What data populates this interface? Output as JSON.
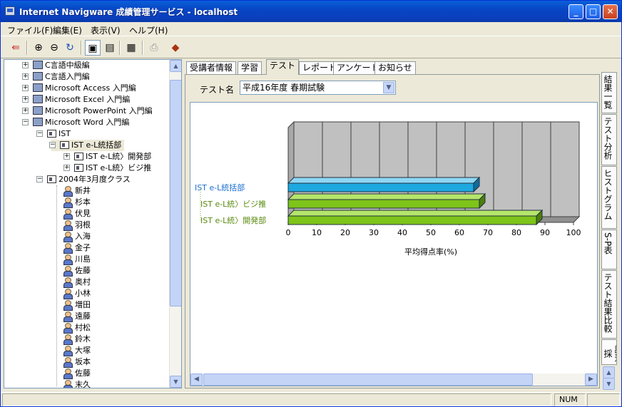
{
  "window": {
    "title": "Internet Navigware 成績管理サービス - localhost"
  },
  "menu": [
    {
      "label": "ファイル(F)"
    },
    {
      "label": "編集(E)"
    },
    {
      "label": "表示(V)"
    },
    {
      "label": "ヘルプ(H)"
    }
  ],
  "toolbar": {
    "icons": [
      "exit-icon",
      "zoom-in-icon",
      "zoom-out-icon",
      "refresh-icon",
      "view-mode-1-icon",
      "view-mode-2-icon",
      "report-icon",
      "print-icon",
      "book-icon"
    ]
  },
  "tree": {
    "courses": [
      "C言語中級編",
      "C言語入門編",
      "Microsoft Access 入門編",
      "Microsoft Excel 入門編",
      "Microsoft PowerPoint 入門編",
      "Microsoft Word 入門編"
    ],
    "org": "IST",
    "org_child": "IST e-L統括部",
    "org_grandchildren": [
      "IST e-L統〉開発部",
      "IST e-L統〉ビジ推"
    ],
    "class": "2004年3月度クラス",
    "students": [
      "新井",
      "杉本",
      "伏見",
      "羽根",
      "入海",
      "金子",
      "川島",
      "佐藤",
      "奥村",
      "小林",
      "増田",
      "遠藤",
      "村松",
      "鈴木",
      "大塚",
      "坂本",
      "佐藤",
      "末久"
    ]
  },
  "tabs": [
    "受講者情報",
    "学習",
    "テスト",
    "レポート",
    "アンケート",
    "お知らせ"
  ],
  "active_tab": "テスト",
  "test_select": {
    "label": "テスト名",
    "value": "平成16年度 春期試験"
  },
  "vertical_tabs": [
    "結果一覧",
    "テスト分析",
    "ヒストグラム",
    "S-P表",
    "テスト結果比較",
    "論述採"
  ],
  "chart_data": {
    "type": "bar",
    "orientation": "horizontal",
    "categories": [
      "IST e-L統括部",
      "IST e-L統〉ビジ推",
      "IST e-L統〉開発部"
    ],
    "values": [
      65,
      67,
      87
    ],
    "colors": [
      "#1ea8e0",
      "#7ec41a",
      "#7ec41a"
    ],
    "xlabel": "平均得点率(%)",
    "xlim": [
      0,
      100
    ],
    "xticks": [
      0,
      10,
      20,
      30,
      40,
      50,
      60,
      70,
      80,
      90,
      100
    ],
    "grid": true
  },
  "status": {
    "indicator": "NUM"
  }
}
